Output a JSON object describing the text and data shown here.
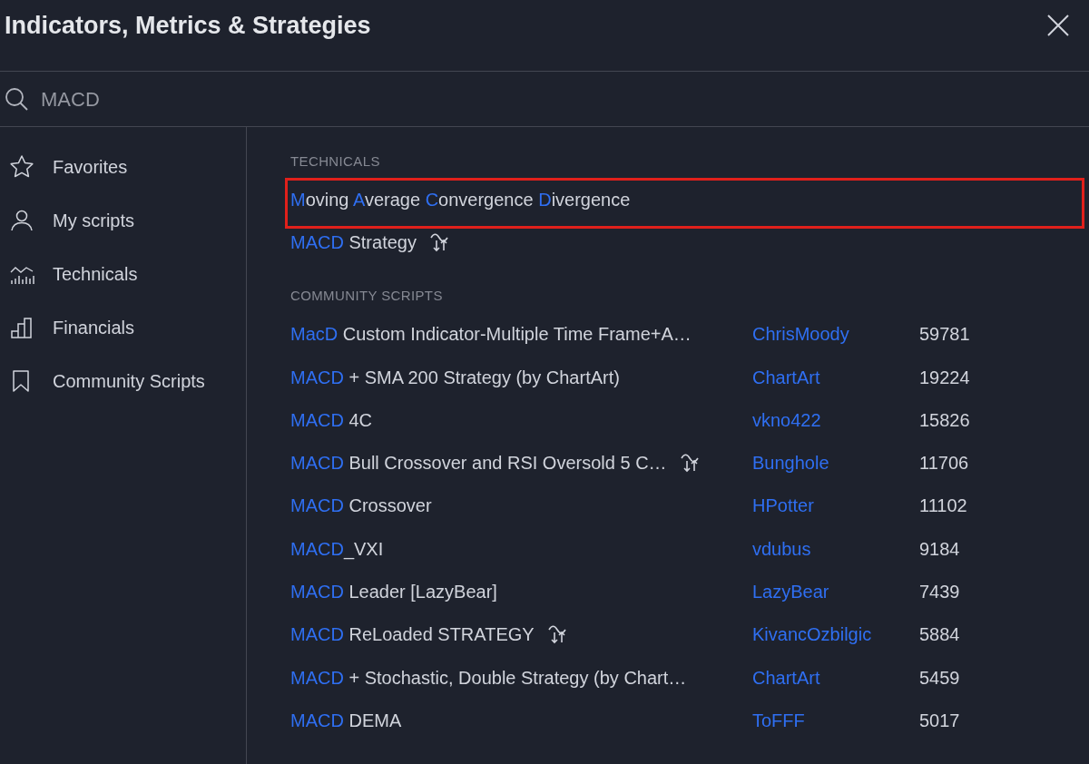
{
  "window": {
    "title": "Indicators, Metrics & Strategies"
  },
  "search": {
    "value": "MACD"
  },
  "sidebar": {
    "items": [
      {
        "label": "Favorites"
      },
      {
        "label": "My scripts"
      },
      {
        "label": "Technicals"
      },
      {
        "label": "Financials"
      },
      {
        "label": "Community Scripts"
      }
    ]
  },
  "sections": [
    {
      "heading": "TECHNICALS",
      "rows": [
        {
          "name": [
            {
              "text": "M",
              "match": true
            },
            {
              "text": "oving ",
              "match": false
            },
            {
              "text": "A",
              "match": true
            },
            {
              "text": "verage ",
              "match": false
            },
            {
              "text": "C",
              "match": true
            },
            {
              "text": "onvergence ",
              "match": false
            },
            {
              "text": "D",
              "match": true
            },
            {
              "text": "ivergence",
              "match": false
            }
          ],
          "strategy": false,
          "highlighted": true
        },
        {
          "name": [
            {
              "text": "MACD",
              "match": true
            },
            {
              "text": " Strategy",
              "match": false
            }
          ],
          "strategy": true,
          "highlighted": false
        }
      ]
    },
    {
      "heading": "COMMUNITY SCRIPTS",
      "rows": [
        {
          "name": [
            {
              "text": "MacD",
              "match": true
            },
            {
              "text": " Custom Indicator-Multiple Time Frame+A…",
              "match": false
            }
          ],
          "strategy": false,
          "highlighted": false,
          "author": "ChrisMoody",
          "count": "59781"
        },
        {
          "name": [
            {
              "text": "MACD",
              "match": true
            },
            {
              "text": " + SMA 200 Strategy (by ChartArt)",
              "match": false
            }
          ],
          "strategy": false,
          "highlighted": false,
          "author": "ChartArt",
          "count": "19224"
        },
        {
          "name": [
            {
              "text": "MACD",
              "match": true
            },
            {
              "text": " 4C",
              "match": false
            }
          ],
          "strategy": false,
          "highlighted": false,
          "author": "vkno422",
          "count": "15826"
        },
        {
          "name": [
            {
              "text": "MACD",
              "match": true
            },
            {
              "text": " Bull Crossover and RSI Oversold 5 C…",
              "match": false
            }
          ],
          "strategy": true,
          "highlighted": false,
          "author": "Bunghole",
          "count": "11706"
        },
        {
          "name": [
            {
              "text": "MACD",
              "match": true
            },
            {
              "text": " Crossover",
              "match": false
            }
          ],
          "strategy": false,
          "highlighted": false,
          "author": "HPotter",
          "count": "11102"
        },
        {
          "name": [
            {
              "text": "MACD",
              "match": true
            },
            {
              "text": "_VXI",
              "match": false
            }
          ],
          "strategy": false,
          "highlighted": false,
          "author": "vdubus",
          "count": "9184"
        },
        {
          "name": [
            {
              "text": "MACD",
              "match": true
            },
            {
              "text": " Leader [LazyBear]",
              "match": false
            }
          ],
          "strategy": false,
          "highlighted": false,
          "author": "LazyBear",
          "count": "7439"
        },
        {
          "name": [
            {
              "text": "MACD",
              "match": true
            },
            {
              "text": " ReLoaded STRATEGY",
              "match": false
            }
          ],
          "strategy": true,
          "highlighted": false,
          "author": "KivancOzbilgic",
          "count": "5884"
        },
        {
          "name": [
            {
              "text": "MACD",
              "match": true
            },
            {
              "text": " + Stochastic, Double Strategy (by Chart…",
              "match": false
            }
          ],
          "strategy": false,
          "highlighted": false,
          "author": "ChartArt",
          "count": "5459"
        },
        {
          "name": [
            {
              "text": "MACD",
              "match": true
            },
            {
              "text": " DEMA",
              "match": false
            }
          ],
          "strategy": false,
          "highlighted": false,
          "author": "ToFFF",
          "count": "5017"
        }
      ]
    }
  ]
}
